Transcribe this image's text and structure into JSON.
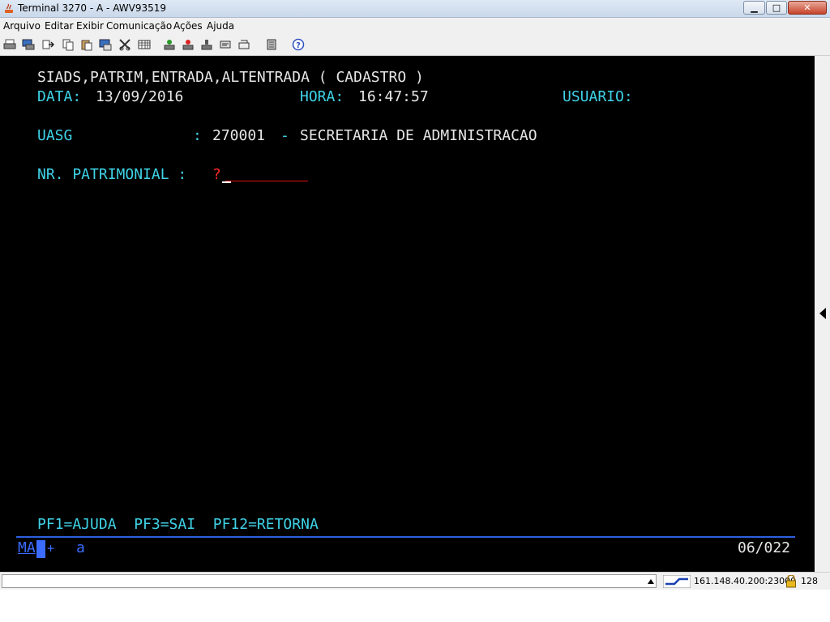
{
  "window": {
    "title": "Terminal 3270 - A - AWV93519",
    "min_glyph": "▁",
    "max_glyph": "□",
    "close_glyph": "✕"
  },
  "menu": [
    "Arquivo",
    "Editar",
    "Exibir",
    "Comunicação",
    "Ações",
    "Ajuda"
  ],
  "toolbar_icons": [
    "print-icon",
    "print-screen-icon",
    "send-icon",
    "copy-icon",
    "paste-icon",
    "cut-icon",
    "macro-icon",
    "keypad-icon",
    "record-icon",
    "stop-icon",
    "play-icon",
    "settings-icon",
    "transfer-icon",
    "help-icon"
  ],
  "screen": {
    "header_line": "SIADS,PATRIM,ENTRADA,ALTENTRADA ( CADASTRO )",
    "data_label": "DATA:",
    "data_value": "13/09/2016",
    "hora_label": "HORA:",
    "hora_value": "16:47:57",
    "usuario_label": "USUARIO:",
    "uasg_label": "UASG",
    "uasg_colon": ":",
    "uasg_code": "270001",
    "uasg_dash": "-",
    "uasg_name": "SECRETARIA DE ADMINISTRACAO",
    "patrimonial_label": "NR. PATRIMONIAL :",
    "patrimonial_prompt": "?",
    "pf_keys": "PF1=AJUDA  PF3=SAI  PF12=RETORNA",
    "oia_left": "MA",
    "oia_plus": "+",
    "oia_a": "a",
    "cursor_pos": "06/022"
  },
  "statusbar": {
    "host": "161.148.40.200:23000",
    "key_bits": "128"
  },
  "colors": {
    "terminal_bg": "#000000",
    "field_cyan": "#3fd3e8",
    "text_white": "#e6e6e6",
    "prompt_red": "#ff2a2a",
    "oia_blue": "#3b6cff"
  }
}
